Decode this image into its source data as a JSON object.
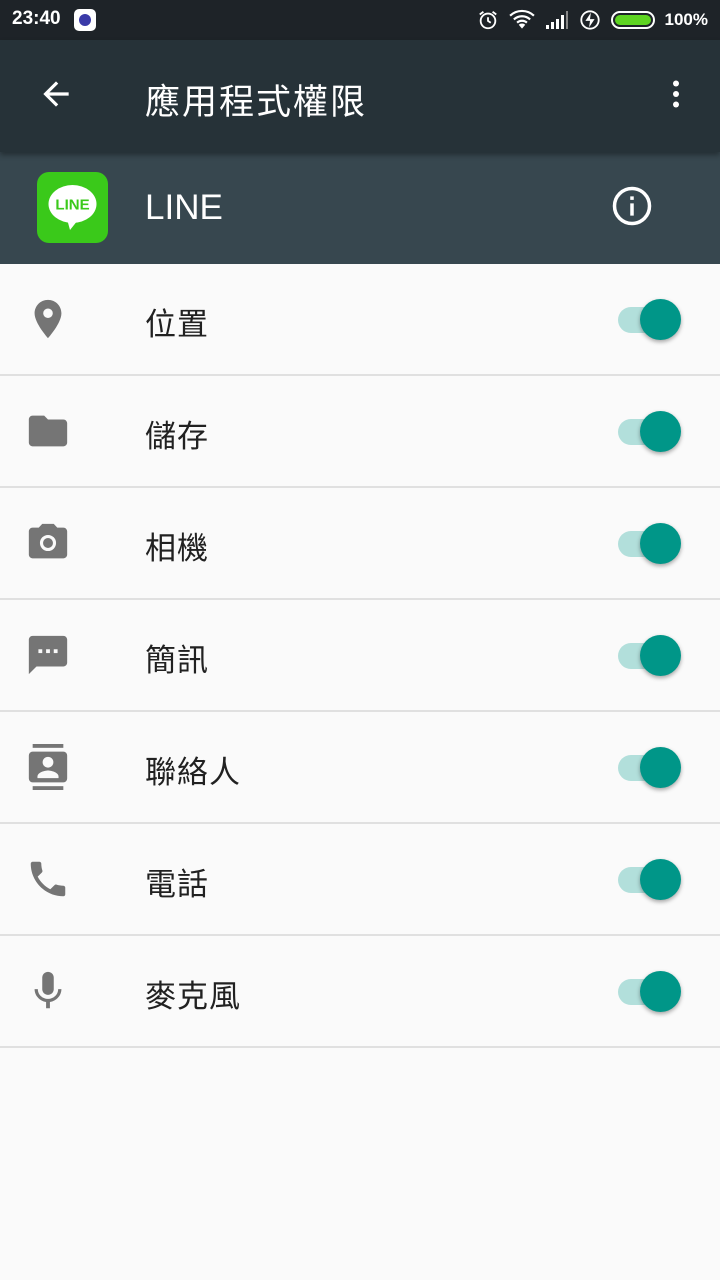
{
  "status_bar": {
    "time": "23:40",
    "battery_percent": "100%",
    "battery_level": 1.0,
    "icons": [
      "notification-app-icon",
      "alarm-icon",
      "wifi-icon",
      "signal-icon",
      "charging-icon",
      "battery-icon"
    ]
  },
  "toolbar": {
    "title": "應用程式權限",
    "back_icon": "arrow-back-icon",
    "overflow_icon": "more-vert-icon"
  },
  "app": {
    "name": "LINE",
    "icon_text": "LINE",
    "brand_color": "#3ac91a",
    "info_icon": "info-icon"
  },
  "permissions": [
    {
      "label": "位置",
      "icon": "location-pin-icon",
      "enabled": true
    },
    {
      "label": "儲存",
      "icon": "folder-icon",
      "enabled": true
    },
    {
      "label": "相機",
      "icon": "camera-icon",
      "enabled": true
    },
    {
      "label": "簡訊",
      "icon": "message-icon",
      "enabled": true
    },
    {
      "label": "聯絡人",
      "icon": "contacts-icon",
      "enabled": true
    },
    {
      "label": "電話",
      "icon": "phone-icon",
      "enabled": true
    },
    {
      "label": "麥克風",
      "icon": "microphone-icon",
      "enabled": true
    }
  ],
  "colors": {
    "toolbar": "#263238",
    "app_header": "#37474f",
    "switch_on": "#009688",
    "switch_track_on": "#b2dfdb",
    "icon_gray": "#757575"
  }
}
